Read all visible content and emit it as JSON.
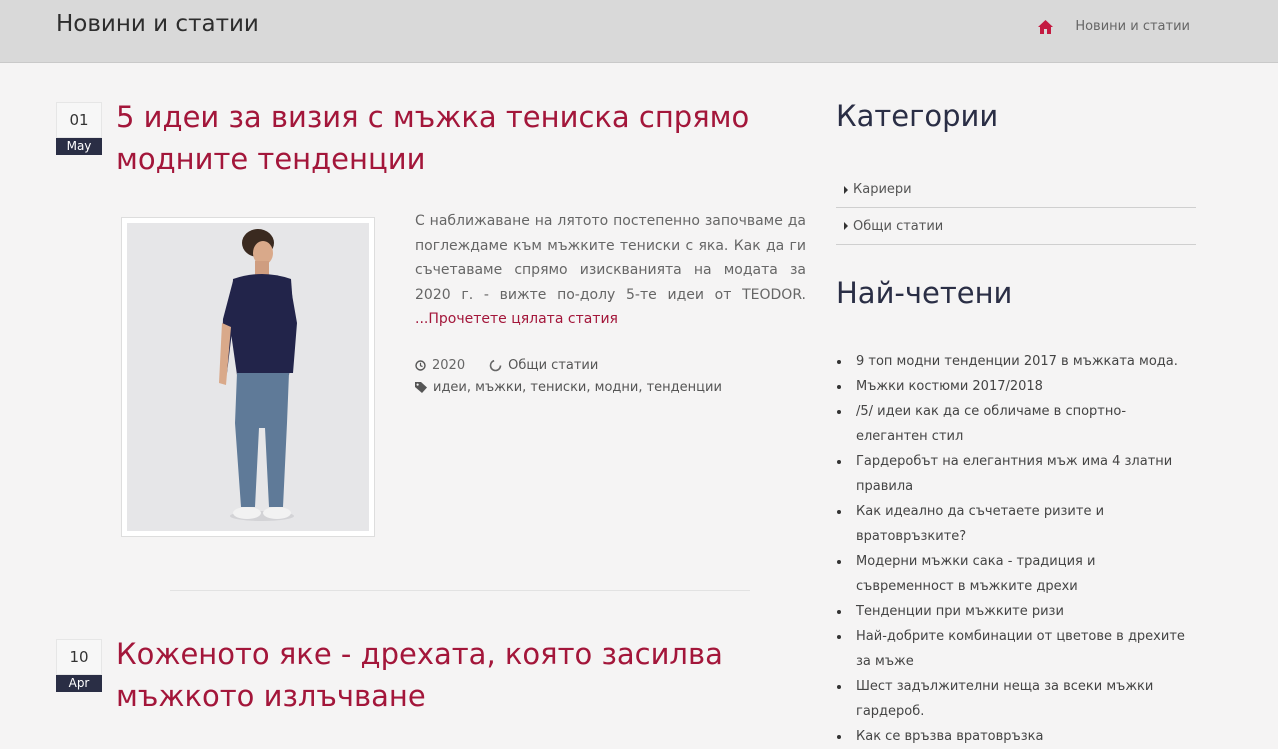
{
  "header": {
    "title": "Новини и статии",
    "breadcrumb_current": "Новини и статии",
    "home_icon_color": "#c41a41"
  },
  "posts": [
    {
      "day": "01",
      "month": "May",
      "title": "5 идеи за визия с мъжка тениска спрямо модните тенденции",
      "excerpt": "С наближаване на лятото постепенно започваме да поглеждаме към мъжките тениски с яка. Как да ги съчетаваме спрямо изискванията на модата за 2020 г. - вижте по-долу 5-те идеи от TEODOR.",
      "read_more": "...Прочетете цялата статия",
      "year": "2020",
      "category": "Общи статии",
      "tags": "идеи, мъжки, тениски, модни, тенденции"
    },
    {
      "day": "10",
      "month": "Apr",
      "title": "Коженото яке - дрехата, която засилва мъжкото излъчване"
    }
  ],
  "sidebar": {
    "categories_title": "Категории",
    "categories": [
      "Кариери",
      "Общи статии"
    ],
    "popular_title": "Най-четени",
    "popular": [
      "9 топ модни тенденции 2017 в мъжката мода.",
      "Мъжки костюми 2017/2018",
      "/5/ идеи как да се обличаме в спортно-елегантен стил",
      "Гардеробът на елегантния мъж има 4 златни правила",
      "Как идеално да съчетаете ризите и вратовръзките?",
      "Модерни мъжки сака - традиция и съвременност в мъжките дрехи",
      "Тенденции при мъжките ризи",
      "Най-добрите комбинации от цветове в дрехите за мъже",
      "Шест задължителни неща за всеки мъжки гардероб.",
      "Как се връзва вратовръзка"
    ]
  },
  "colors": {
    "accent": "#a3163a",
    "navy": "#2a2e45",
    "header_bg": "#d9d9d9"
  }
}
